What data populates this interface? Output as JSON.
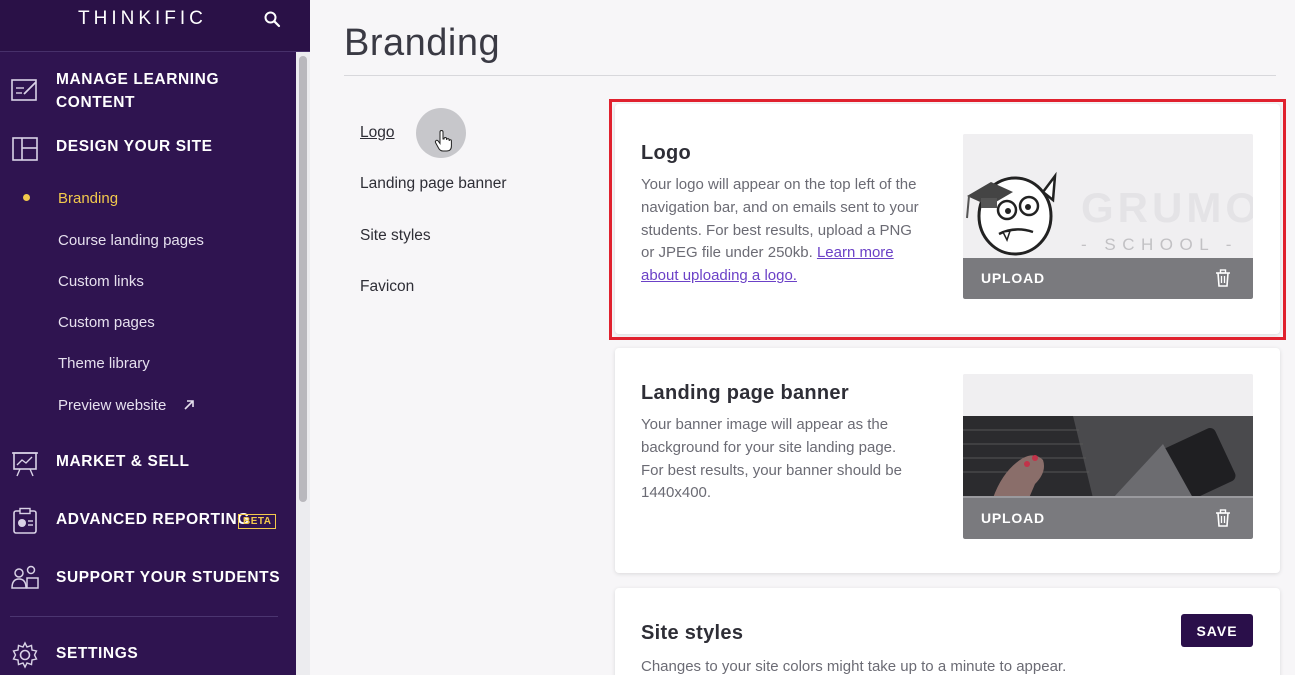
{
  "sidebar": {
    "brand": "THINKIFIC",
    "sections": [
      {
        "label_line1": "MANAGE LEARNING",
        "label_line2": "CONTENT",
        "icon": "edit-board-icon"
      },
      {
        "label": "DESIGN YOUR SITE",
        "icon": "layout-icon"
      },
      {
        "label": "MARKET & SELL",
        "icon": "presentation-chart-icon"
      },
      {
        "label": "ADVANCED REPORTING",
        "icon": "report-clipboard-icon",
        "badge": "BETA"
      },
      {
        "label": "SUPPORT YOUR STUDENTS",
        "icon": "people-icon"
      },
      {
        "label": "SETTINGS",
        "icon": "gear-icon"
      }
    ],
    "design_subitems": [
      {
        "label": "Branding",
        "active": true
      },
      {
        "label": "Course landing pages"
      },
      {
        "label": "Custom links"
      },
      {
        "label": "Custom pages"
      },
      {
        "label": "Theme library"
      },
      {
        "label": "Preview website",
        "icon": "external-arrow-icon"
      }
    ]
  },
  "page": {
    "title": "Branding",
    "subnav": [
      "Logo",
      "Landing page banner",
      "Site styles",
      "Favicon"
    ]
  },
  "logo_card": {
    "title": "Logo",
    "desc_lines": [
      "Your logo will appear on the top left of the",
      "navigation bar, and on emails sent to your",
      "students. For best results, upload a PNG",
      "or JPEG file under 250kb. "
    ],
    "link_line1": "Learn more",
    "link_line2": "about uploading a logo.",
    "upload_label": "UPLOAD",
    "preview_text": "- SCHOOL -"
  },
  "banner_card": {
    "title": "Landing page banner",
    "desc_lines": [
      "Your banner image will appear as the",
      "background for your site landing page.",
      "For best results, your banner should be",
      "1440x400."
    ],
    "upload_label": "UPLOAD"
  },
  "styles_card": {
    "title": "Site styles",
    "desc": "Changes to your site colors might take up to a minute to appear.",
    "save_label": "SAVE"
  },
  "colors": {
    "sidebar_bg": "#2f1450",
    "active_accent": "#f2c94c",
    "highlight_border": "#e0212e",
    "save_button": "#2a0f4a",
    "link": "#6b41c7"
  }
}
